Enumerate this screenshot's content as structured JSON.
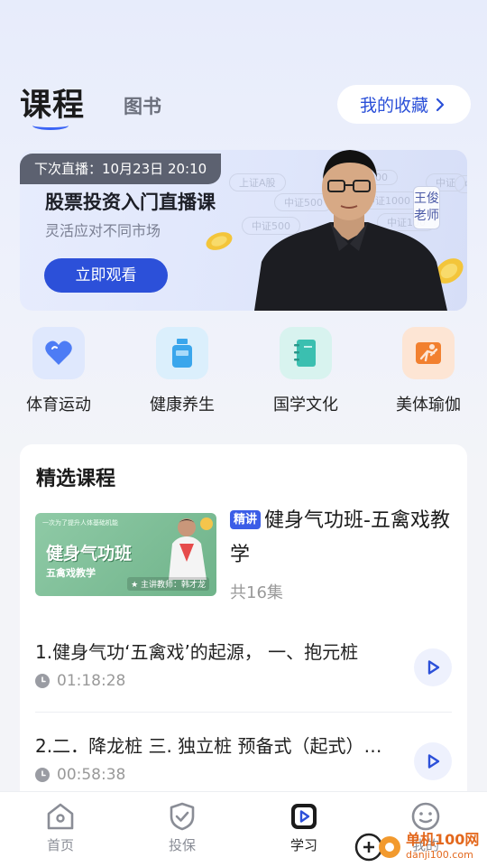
{
  "header": {
    "active_tab": "课程",
    "inactive_tab": "图书",
    "favorites_label": "我的收藏"
  },
  "banner": {
    "next_live": "下次直播：10月23日 20:10",
    "title": "股票投资入门直播课",
    "subtitle": "灵活应对不同市场",
    "watch_button": "立即观看",
    "teacher": "王俊老师",
    "bg_tags": [
      "上证A股",
      "000",
      "中证500",
      "中证",
      "中证1000",
      "中证500",
      "中证100",
      "中"
    ]
  },
  "categories": [
    {
      "label": "体育运动",
      "icon": "heart-icon",
      "color": "#4d7cf5"
    },
    {
      "label": "健康养生",
      "icon": "bottle-icon",
      "color": "#3aa6ec"
    },
    {
      "label": "国学文化",
      "icon": "notebook-icon",
      "color": "#3bbfb0"
    },
    {
      "label": "美体瑜伽",
      "icon": "yoga-icon",
      "color": "#f2802f"
    }
  ],
  "featured": {
    "heading": "精选课程",
    "course": {
      "badge": "精讲",
      "title": "健身气功班-五禽戏教学",
      "count": "共16集",
      "thumb_title": "健身气功班",
      "thumb_sub": "五禽戏教学",
      "thumb_tag": "一次为了提升人体基础机能",
      "thumb_teacher": "★ 主讲教师：韩才龙"
    },
    "lessons": [
      {
        "title": "1.健身气功‘五禽戏’的起源， 一、抱元桩",
        "duration": "01:18:28"
      },
      {
        "title": "2.二．降龙桩 三. 独立桩 预备式（起式）…",
        "duration": "00:58:38"
      }
    ]
  },
  "bottom_nav": [
    {
      "label": "首页",
      "icon": "home-icon",
      "active": false
    },
    {
      "label": "投保",
      "icon": "shield-icon",
      "active": false
    },
    {
      "label": "学习",
      "icon": "play-icon",
      "active": true
    },
    {
      "label": "我的",
      "icon": "smile-icon",
      "active": false
    }
  ],
  "watermark": {
    "name": "单机100网",
    "url": "danji100.com"
  },
  "colors": {
    "accent": "#2c50d9",
    "badge": "#3b5de7"
  }
}
